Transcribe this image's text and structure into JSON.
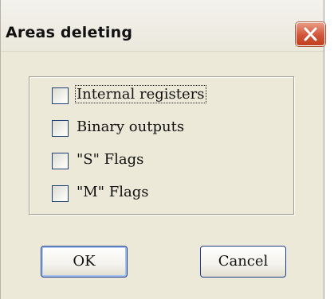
{
  "window": {
    "title": "Areas deleting"
  },
  "options": [
    {
      "label": "Internal registers",
      "checked": false,
      "focused": true
    },
    {
      "label": "Binary outputs",
      "checked": false,
      "focused": false
    },
    {
      "label": "\"S\" Flags",
      "checked": false,
      "focused": false
    },
    {
      "label": "\"M\" Flags",
      "checked": false,
      "focused": false
    }
  ],
  "buttons": {
    "ok_label": "OK",
    "cancel_label": "Cancel"
  },
  "icons": {
    "close": "close-icon"
  },
  "colors": {
    "close_button": "#d2553a",
    "dialog_background": "#ece9d8",
    "checkbox_border": "#1f3f78",
    "button_border": "#1f3c8a"
  }
}
